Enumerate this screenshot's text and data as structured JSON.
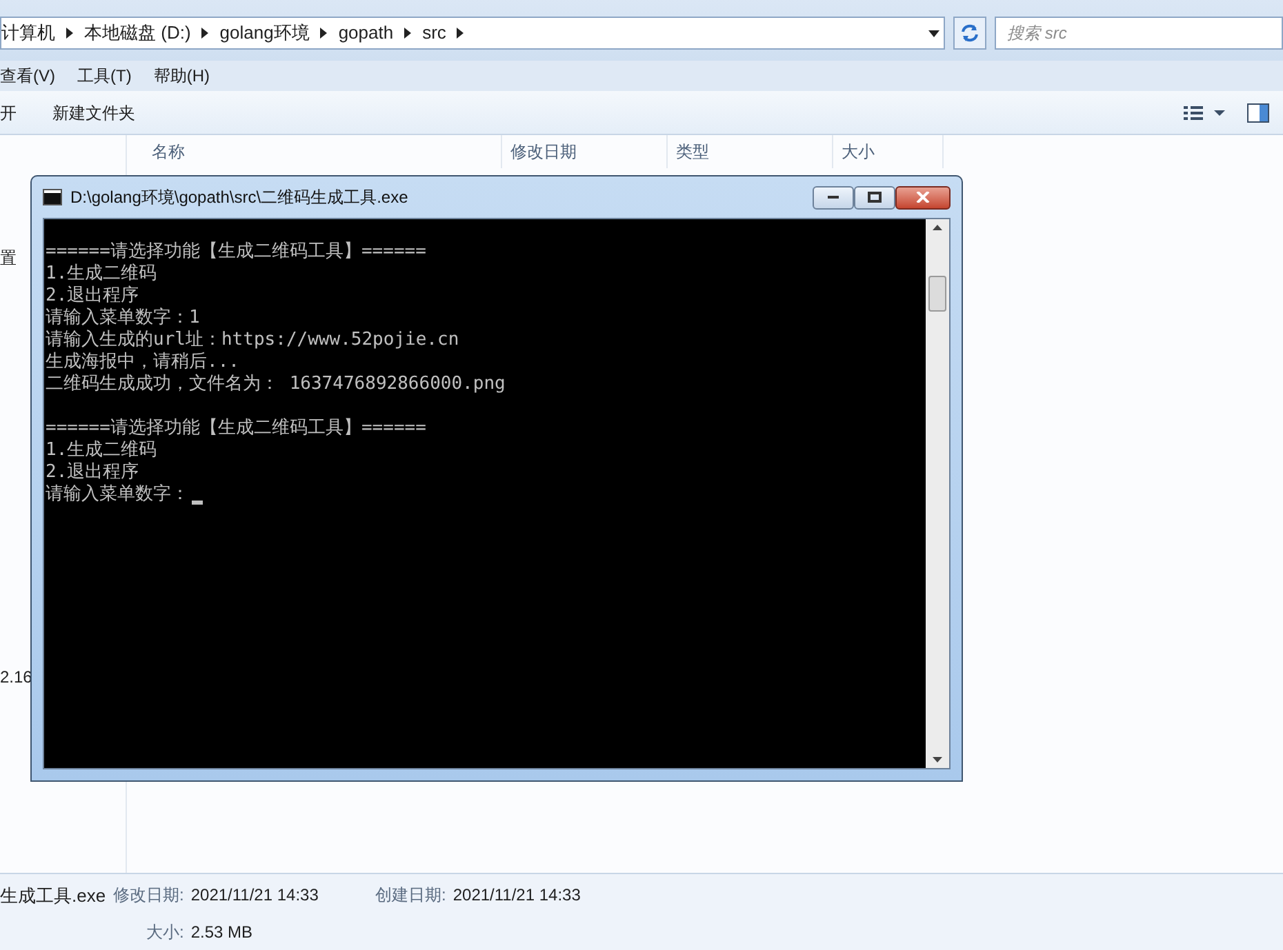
{
  "address_bar": {
    "crumbs": [
      "计算机",
      "本地磁盘 (D:)",
      "golang环境",
      "gopath",
      "src"
    ]
  },
  "search": {
    "placeholder": "搜索 src"
  },
  "menu_bar": [
    "查看(V)",
    "工具(T)",
    "帮助(H)"
  ],
  "toolbar": [
    "开",
    "新建文件夹"
  ],
  "columns": [
    "名称",
    "修改日期",
    "类型",
    "大小"
  ],
  "nav_fragments": [
    "置",
    "2.16"
  ],
  "console_window": {
    "title": "D:\\golang环境\\gopath\\src\\二维码生成工具.exe",
    "blocks": [
      [
        "======请选择功能【生成二维码工具】======",
        "1.生成二维码",
        "2.退出程序",
        "请输入菜单数字：1",
        "请输入生成的url址：https://www.52pojie.cn",
        "生成海报中，请稍后...",
        "二维码生成成功，文件名为： 1637476892866000.png"
      ],
      [
        "======请选择功能【生成二维码工具】======",
        "1.生成二维码",
        "2.退出程序",
        "请输入菜单数字："
      ]
    ]
  },
  "details": {
    "file_name": "生成工具.exe",
    "fields": [
      {
        "label": "修改日期:",
        "value": "2021/11/21 14:33"
      },
      {
        "label": "创建日期:",
        "value": "2021/11/21 14:33"
      },
      {
        "label": "大小:",
        "value": "2.53 MB"
      }
    ]
  }
}
